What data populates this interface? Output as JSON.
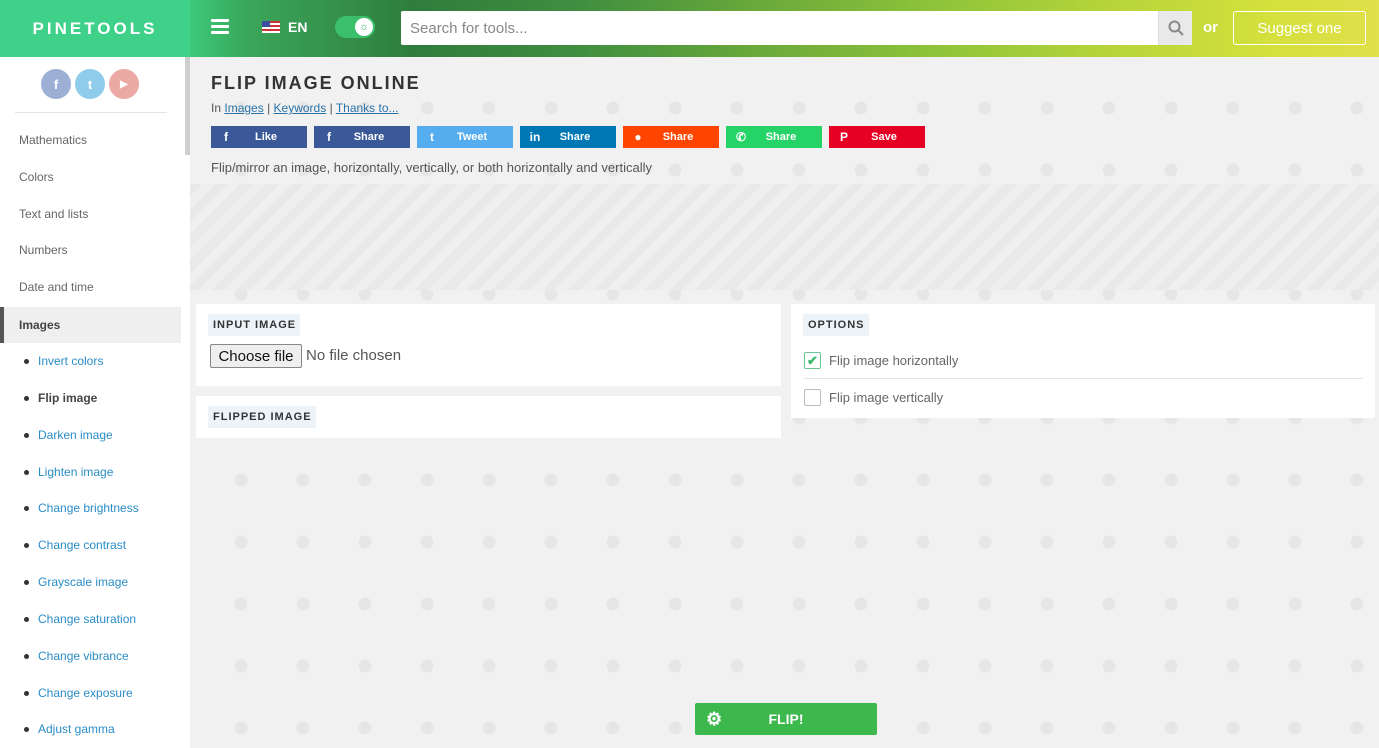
{
  "header": {
    "logo": "PINETOOLS",
    "language": "EN",
    "search_placeholder": "Search for tools...",
    "or_text": "or",
    "suggest_label": "Suggest one"
  },
  "sidebar": {
    "social": [
      {
        "icon": "facebook-icon",
        "glyph": "f",
        "color": "#9bb0d4"
      },
      {
        "icon": "twitter-icon",
        "glyph": "t",
        "color": "#8fcbea"
      },
      {
        "icon": "youtube-icon",
        "glyph": "▶",
        "color": "#eaa9a2"
      }
    ],
    "categories": [
      "Mathematics",
      "Colors",
      "Text and lists",
      "Numbers",
      "Date and time",
      "Images"
    ],
    "subitems": [
      "Invert colors",
      "Flip image",
      "Darken image",
      "Lighten image",
      "Change brightness",
      "Change contrast",
      "Grayscale image",
      "Change saturation",
      "Change vibrance",
      "Change exposure",
      "Adjust gamma"
    ]
  },
  "page": {
    "title": "FLIP IMAGE ONLINE",
    "in_text": "In",
    "crumb_images": "Images",
    "crumb_keywords": "Keywords",
    "crumb_thanks": "Thanks to...",
    "crumb_sep": "|",
    "description": "Flip/mirror an image, horizontally, vertically, or both horizontally and vertically"
  },
  "share_buttons": [
    {
      "label": "Like",
      "glyph": "f",
      "color": "#3b5998"
    },
    {
      "label": "Share",
      "glyph": "f",
      "color": "#3b5998"
    },
    {
      "label": "Tweet",
      "glyph": "t",
      "color": "#55acee"
    },
    {
      "label": "Share",
      "glyph": "in",
      "color": "#0077b5"
    },
    {
      "label": "Share",
      "glyph": "●",
      "color": "#ff4500"
    },
    {
      "label": "Share",
      "glyph": "✆",
      "color": "#25d366"
    },
    {
      "label": "Save",
      "glyph": "P",
      "color": "#e60023"
    }
  ],
  "input_panel": {
    "label": "INPUT IMAGE",
    "choose_file": "Choose file",
    "no_file": "No file chosen"
  },
  "flipped_panel": {
    "label": "FLIPPED IMAGE"
  },
  "options": {
    "label": "OPTIONS",
    "horizontal": {
      "label": "Flip image horizontally",
      "checked": true,
      "mark": "✔"
    },
    "vertical": {
      "label": "Flip image vertically",
      "checked": false,
      "mark": ""
    }
  },
  "action": {
    "flip_label": "FLIP!"
  }
}
